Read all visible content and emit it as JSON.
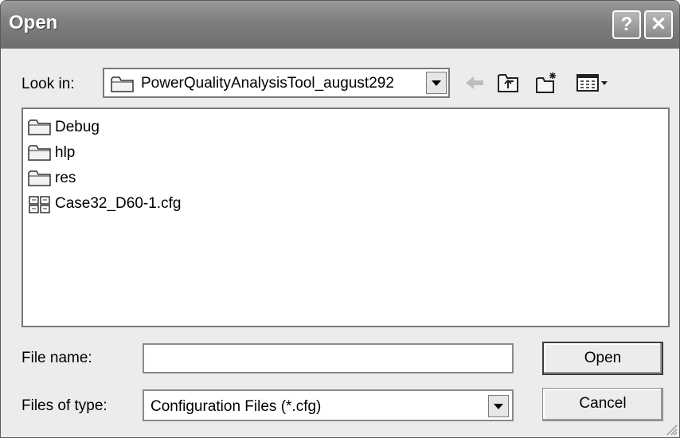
{
  "window": {
    "title": "Open"
  },
  "titlebar": {
    "help_glyph": "?",
    "close_glyph": "✕",
    "help_icon": "help-icon",
    "close_icon": "close-icon"
  },
  "lookin": {
    "label": "Look in:",
    "value": "PowerQualityAnalysisTool_august292",
    "icon": "folder-icon"
  },
  "toolbar": {
    "icons": [
      "back-arrow-icon",
      "up-folder-icon",
      "new-folder-icon",
      "view-menu-icon"
    ]
  },
  "files": [
    {
      "name": "Debug",
      "icon": "folder-icon"
    },
    {
      "name": "hlp",
      "icon": "folder-icon"
    },
    {
      "name": "res",
      "icon": "folder-icon"
    },
    {
      "name": "Case32_D60-1.cfg",
      "icon": "cfg-file-icon"
    }
  ],
  "filename": {
    "label": "File name:",
    "value": ""
  },
  "filetype": {
    "label": "Files of type:",
    "value": "Configuration Files (*.cfg)"
  },
  "buttons": {
    "open": "Open",
    "cancel": "Cancel"
  }
}
